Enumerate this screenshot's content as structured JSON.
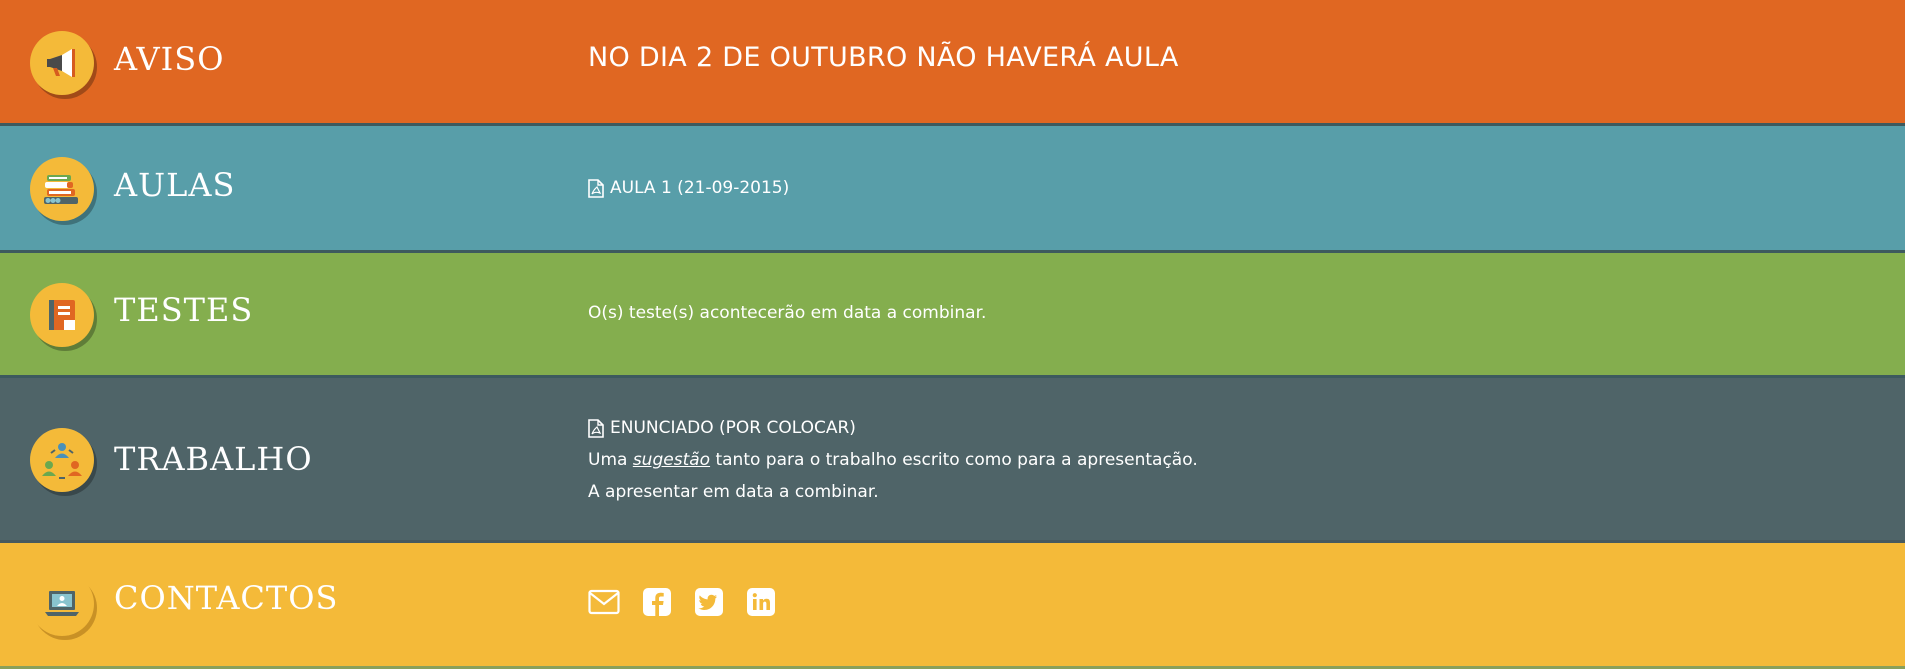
{
  "sections": {
    "aviso": {
      "title": "AVISO",
      "icon": "megaphone-icon",
      "message": "NO DIA 2 DE OUTUBRO NÃO HAVERÁ AULA"
    },
    "aulas": {
      "title": "AULAS",
      "icon": "books-icon",
      "items": [
        {
          "label": "AULA 1 (21-09-2015)",
          "icon": "file-pdf-icon"
        }
      ]
    },
    "testes": {
      "title": "TESTES",
      "icon": "notebook-icon",
      "text": "O(s) teste(s) acontecerão em data a combinar."
    },
    "trabalho": {
      "title": "TRABALHO",
      "icon": "team-cycle-icon",
      "enunciado": "ENUNCIADO (POR COLOCAR)",
      "line1_prefix": "Uma",
      "line1_link": "sugestão",
      "line1_suffix": "tanto para o trabalho escrito como para a apresentação.",
      "line2": "A apresentar em data a combinar."
    },
    "contactos": {
      "title": "CONTACTOS",
      "icon": "laptop-user-icon",
      "links": [
        "envelope-icon",
        "facebook-icon",
        "twitter-icon",
        "linkedin-icon"
      ]
    }
  },
  "colors": {
    "aviso": "#e06722",
    "aulas": "#589ea9",
    "testes": "#84ae4e",
    "trabalho": "#4f6468",
    "contactos": "#f4ba39"
  }
}
